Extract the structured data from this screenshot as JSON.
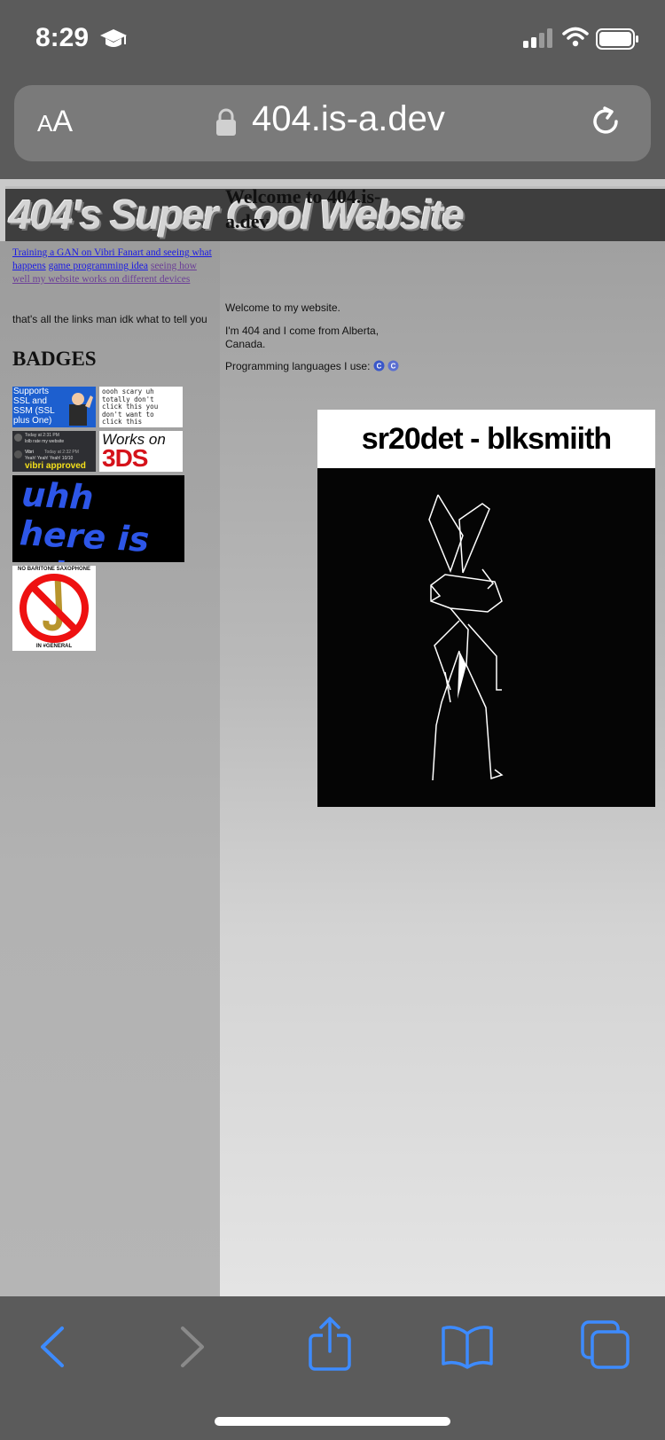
{
  "status_bar": {
    "time": "8:29",
    "icons": [
      "graduation-cap-icon",
      "signal-icon",
      "wifi-icon",
      "battery-icon"
    ]
  },
  "browser": {
    "text_size_label_small": "A",
    "text_size_label_large": "A",
    "url": "404.is-a.dev"
  },
  "site": {
    "banner_title": "404's Super Cool Website",
    "sidebar_links": [
      {
        "label": "Training a GAN on Vibri Fanart and seeing what happens",
        "visited": false
      },
      {
        "label": "game programming idea",
        "visited": false
      },
      {
        "label": "seeing how well my website works on different devices",
        "visited": true
      }
    ],
    "sidebar_text": "that's all the links man idk what to tell you",
    "badges_heading": "BADGES",
    "badges": {
      "ssl": "Supports SSL and SSM (SSL plus One)",
      "scary": "oooh scary uh totally don't click this you don't want to click this",
      "vibri_approved": "vibri approved",
      "vibri_chat_1": "Today at 2:31 PM",
      "vibri_chat_2": "lolb rate my website",
      "vibri_chat_3": "Vibri",
      "vibri_chat_4": "Today at 2:32 PM",
      "vibri_chat_5": "Yeah! Yeah! Yeah! 10/10",
      "works_on": "Works on",
      "works_on_3ds": "3DS",
      "uhh": "uhh here is a badge",
      "sax_top": "NO BARITONE SAXOPHONE",
      "sax_bottom": "IN #GENERAL"
    },
    "welcome_heading": "Welcome to 404.is-a.dev",
    "intro": "Welcome to my website.",
    "about": "I'm 404 and I come from Alberta, Canada.",
    "languages_label": "Programming languages I use:",
    "language_icons": [
      "c-icon",
      "cpp-icon"
    ],
    "album_title": "sr20det - blksmiith"
  },
  "toolbar": {
    "icons": [
      "back-icon",
      "forward-icon",
      "share-icon",
      "bookmarks-icon",
      "tabs-icon"
    ]
  },
  "colors": {
    "chrome": "#5b5b5b",
    "link": "#1a1ae6",
    "visited": "#6b3e98",
    "toolbar_icon": "#3d8bff"
  }
}
